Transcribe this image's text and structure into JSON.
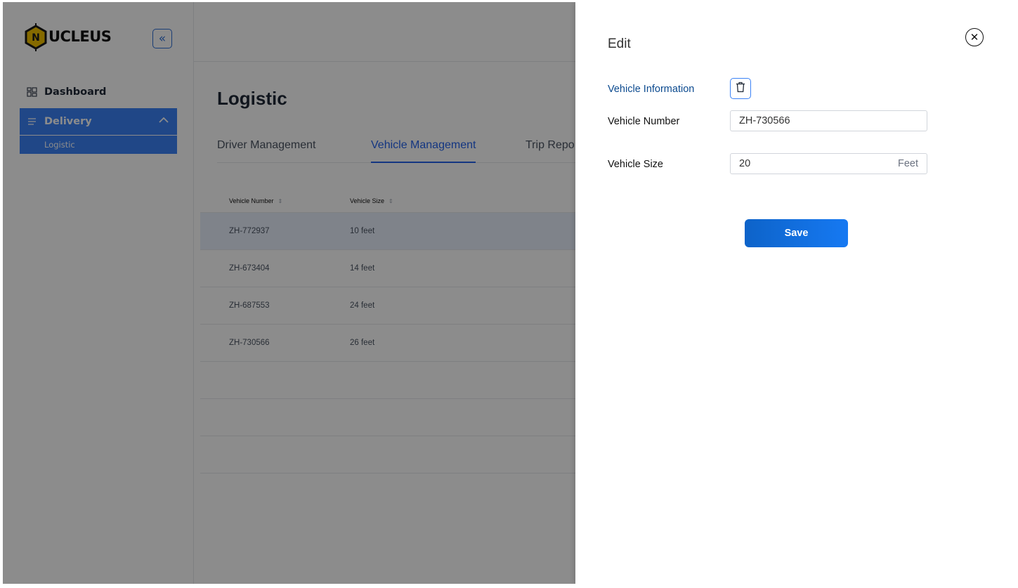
{
  "brand": {
    "logo_letter": "N",
    "logo_text": "UCLEUS"
  },
  "sidebar": {
    "collapse_glyph": "«",
    "items": [
      {
        "label": "Dashboard",
        "icon": "dashboard-grid-icon"
      },
      {
        "label": "Delivery",
        "icon": "delivery-icon",
        "expanded": true,
        "children": [
          {
            "label": "Logistic"
          }
        ]
      }
    ]
  },
  "page": {
    "title": "Logistic",
    "tabs": [
      {
        "label": "Driver Management"
      },
      {
        "label": "Vehicle Management",
        "active": true
      },
      {
        "label": "Trip Repo"
      }
    ]
  },
  "table": {
    "columns": [
      "Vehicle Number",
      "Vehicle Size"
    ],
    "sort_glyph": "⇕",
    "rows": [
      {
        "number": "ZH-772937",
        "size": "10 feet"
      },
      {
        "number": "ZH-673404",
        "size": "14 feet"
      },
      {
        "number": "ZH-687553",
        "size": "24 feet"
      },
      {
        "number": "ZH-730566",
        "size": "26 feet"
      }
    ]
  },
  "drawer": {
    "title": "Edit",
    "close_glyph": "✕",
    "section_label": "Vehicle Information",
    "fields": {
      "vehicle_number": {
        "label": "Vehicle Number",
        "value": "ZH-730566"
      },
      "vehicle_size": {
        "label": "Vehicle Size",
        "value": "20",
        "suffix": "Feet"
      }
    },
    "save_label": "Save"
  },
  "colors": {
    "accent": "#2563eb",
    "section_text": "#0b4a8f",
    "save_button": "#0d63c9"
  }
}
